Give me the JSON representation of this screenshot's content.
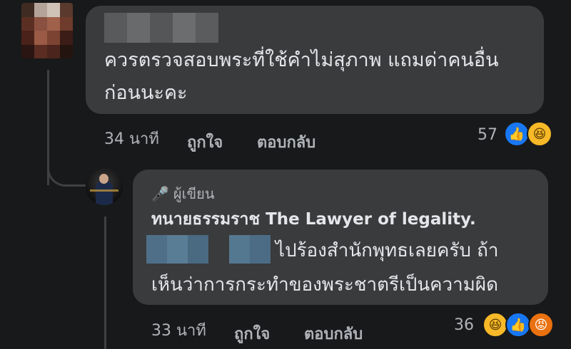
{
  "comments": [
    {
      "author_blurred": true,
      "text_line1": "ควรตรวจสอบพระที่ใช้คำไม่สุภาพ แถมด่าคนอื่น",
      "text_line2": "ก่อนนะคะ",
      "time": "34 นาที",
      "like_label": "ถูกใจ",
      "reply_label": "ตอบกลับ",
      "reaction_count": "57",
      "reactions": [
        "like-icon",
        "haha-icon"
      ]
    },
    {
      "author_badge": "ผู้เขียน",
      "author_name": "ทนายธรรมราช The Lawyer of  legality.",
      "mention_blurred": true,
      "text_line1": "ไปร้องสำนักพุทธเลยครับ ถ้า",
      "text_line2": "เห็นว่าการกระทำของพระชาตรีเป็นความผิด",
      "time": "33 นาที",
      "like_label": "ถูกใจ",
      "reply_label": "ตอบกลับ",
      "reaction_count": "36",
      "reactions": [
        "haha-icon",
        "like-icon",
        "angry-icon"
      ]
    }
  ],
  "colors": {
    "background": "#18191a",
    "bubble": "#3a3b3c",
    "text": "#e4e6eb",
    "muted": "#b0b3b8",
    "like": "#1877f2",
    "haha": "#f7b928",
    "angry": "#e9710f"
  }
}
